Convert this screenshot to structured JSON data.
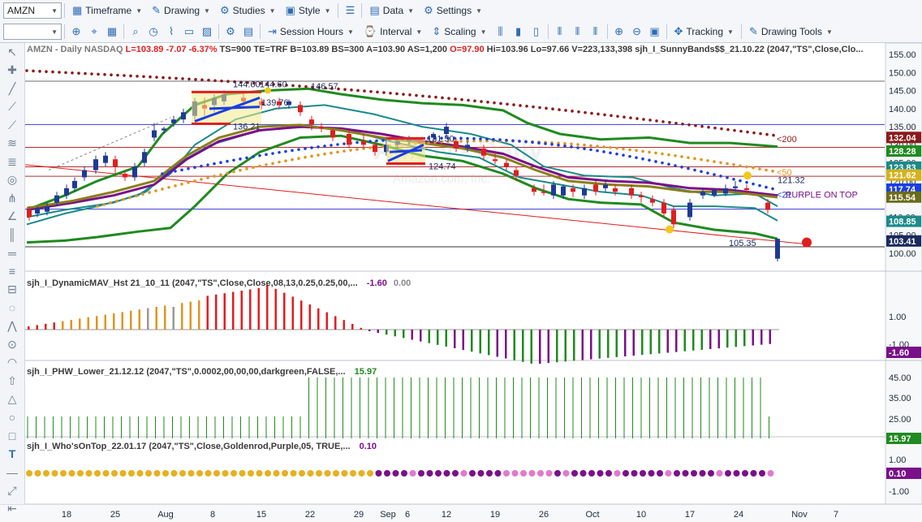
{
  "toolbar": {
    "symbol": "AMZN",
    "timeframe": "Timeframe",
    "drawing": "Drawing",
    "studies": "Studies",
    "style": "Style",
    "data": "Data",
    "settings": "Settings",
    "session_hours": "Session Hours",
    "interval": "Interval",
    "scaling": "Scaling",
    "tracking": "Tracking",
    "drawing_tools": "Drawing Tools"
  },
  "header": {
    "symbol_info": "AMZN - Daily  NASDAQ",
    "L": "L=103.89",
    "chg": "-7.07",
    "pct": "-6.37%",
    "meta": "TS=900  TE=TRF  B=103.89  BS=300  A=103.90  AS=1,200",
    "O": "O=97.90",
    "rest": "Hi=103.96  Lo=97.66  V=223,133,398",
    "study": "sjh_I_SunnyBands$$_21.10.22 (2047,\"TS\",Close,Clo..."
  },
  "watermark": {
    "big": "AMZN - Daily",
    "small": "Amazon.com, Inc."
  },
  "colors": {
    "up": "#1f3a93",
    "down": "#e01e1e",
    "green": "#1f8a1f",
    "olive": "#8a7f1a",
    "purple": "#7a0f8a",
    "teal": "#1b8a8a",
    "brown": "#8b1a1a",
    "orange": "#e0951f",
    "blue": "#1a3fe0"
  },
  "panel_titles": [
    {
      "name": "sjh_I_DynamicMAV_Hst 21_10_11 (2047,\"TS\",Close,Close,08,13,0.25,0.25,00,...",
      "value": "-1.60",
      "value2": "0.00",
      "value_color": "#7a0f8a"
    },
    {
      "name": "sjh_I_PHW_Lower_21.12.12 (2047,\"TS\",0.0002,00,00,00,darkgreen,FALSE,...",
      "value": "15.97",
      "value_color": "#1f8a1f"
    },
    {
      "name": "sjh_I_Who'sOnTop_22.01.17 (2047,\"TS\",Close,Goldenrod,Purple,05, TRUE,...",
      "value": "0.10",
      "value_color": "#7a0f8a"
    }
  ],
  "price_axis": {
    "ticks": [
      "155.00",
      "150.00",
      "145.00",
      "140.00",
      "135.00",
      "130.00",
      "125.00",
      "120.00",
      "115.00",
      "110.00",
      "105.00",
      "100.00"
    ],
    "tags": [
      {
        "text": "132.04",
        "bg": "#8b1a1a"
      },
      {
        "text": "128.28",
        "bg": "#1f8a1f"
      },
      {
        "text": "123.83",
        "bg": "#1b8a8a"
      },
      {
        "text": "121.62",
        "bg": "#d4b21a"
      },
      {
        "text": "117.74",
        "bg": "#1a3fe0"
      },
      {
        "text": "115.54",
        "bg": "#6b6b1a"
      },
      {
        "text": "108.85",
        "bg": "#1b8a8a"
      },
      {
        "text": "103.41",
        "bg": "#1a2a5e"
      }
    ]
  },
  "annotations": {
    "hi1": "144.60",
    "hi2": "144.60",
    "hi3": "146.57",
    "lo1": "139.76",
    "lo2": "136.21",
    "mid1": "131.50",
    "mid2": "124.74",
    "last_lo": "105.35",
    "last_hi": "121.32",
    "ma200": "<200",
    "ma50": "<50",
    "ma21": "<21",
    "purple_on_top": "PURPLE ON TOP"
  },
  "panel1_axis": [
    "1.00",
    "-1.00"
  ],
  "panel1_tag": "-1.60",
  "panel2_axis": [
    "45.00",
    "35.00",
    "25.00"
  ],
  "panel2_tag": "15.97",
  "panel3_axis": [
    "1.00",
    "-1.00"
  ],
  "panel3_tag": "0.10",
  "date_axis": [
    "18",
    "25",
    "Aug",
    "8",
    "15",
    "22",
    "29",
    "Sep",
    "6",
    "12",
    "19",
    "26",
    "Oct",
    "10",
    "17",
    "24",
    "Nov",
    "7"
  ]
}
